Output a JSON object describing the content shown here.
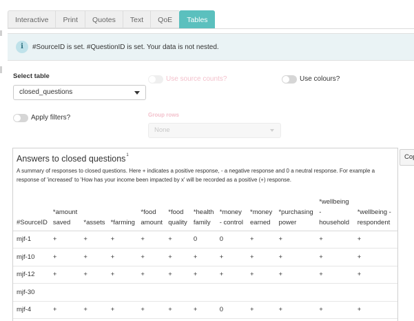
{
  "tabs": [
    {
      "label": "Interactive",
      "active": false
    },
    {
      "label": "Print",
      "active": false
    },
    {
      "label": "Quotes",
      "active": false
    },
    {
      "label": "Text",
      "active": false
    },
    {
      "label": "QoE",
      "active": false
    },
    {
      "label": "Tables",
      "active": true
    }
  ],
  "info": {
    "icon": "i",
    "message": "#SourceID is set. #QuestionID is set. Your data is not nested."
  },
  "controls": {
    "select_table_label": "Select table",
    "select_table_value": "closed_questions",
    "use_source_counts": "Use source counts?",
    "use_colours": "Use colours?",
    "apply_filters": "Apply filters?",
    "group_rows_label": "Group rows",
    "group_rows_value": "None"
  },
  "panel": {
    "title": "Answers to closed questions",
    "title_sup": "1",
    "subtitle": "A summary of responses to closed questions. Here + indicates a positive response, - a negative response and 0 a neutral response. For example a response of 'increased' to 'How has your income been impacted by x' will be recorded as a positive (+) response.",
    "copy_button": "Copy"
  },
  "table": {
    "columns": [
      [
        "#SourceID"
      ],
      [
        "*amount",
        "saved"
      ],
      [
        "*assets"
      ],
      [
        "*farming"
      ],
      [
        "*food",
        "amount"
      ],
      [
        "*food",
        "quality"
      ],
      [
        "*health",
        "family"
      ],
      [
        "*money",
        "- control"
      ],
      [
        "*money",
        "earned"
      ],
      [
        "*purchasing",
        "power"
      ],
      [
        "*wellbeing",
        "-",
        "household"
      ],
      [
        "*wellbeing -",
        "respondent"
      ]
    ],
    "rows": [
      [
        "mjf-1",
        "+",
        "+",
        "+",
        "+",
        "+",
        "0",
        "0",
        "+",
        "+",
        "+",
        "+"
      ],
      [
        "mjf-10",
        "+",
        "+",
        "+",
        "+",
        "+",
        "+",
        "+",
        "+",
        "+",
        "+",
        "+"
      ],
      [
        "mjf-12",
        "+",
        "+",
        "+",
        "+",
        "+",
        "+",
        "+",
        "+",
        "+",
        "+",
        "+"
      ],
      [
        "mjf-30",
        "",
        "",
        "",
        "",
        "",
        "",
        "",
        "",
        "",
        "",
        ""
      ],
      [
        "mjf-4",
        "+",
        "+",
        "+",
        "+",
        "+",
        "+",
        "0",
        "+",
        "+",
        "+",
        "+"
      ]
    ]
  },
  "colors": {
    "accent": "#5bc0be",
    "info_bg": "#eaf3f5",
    "disabled_text": "#f3c1cc"
  }
}
